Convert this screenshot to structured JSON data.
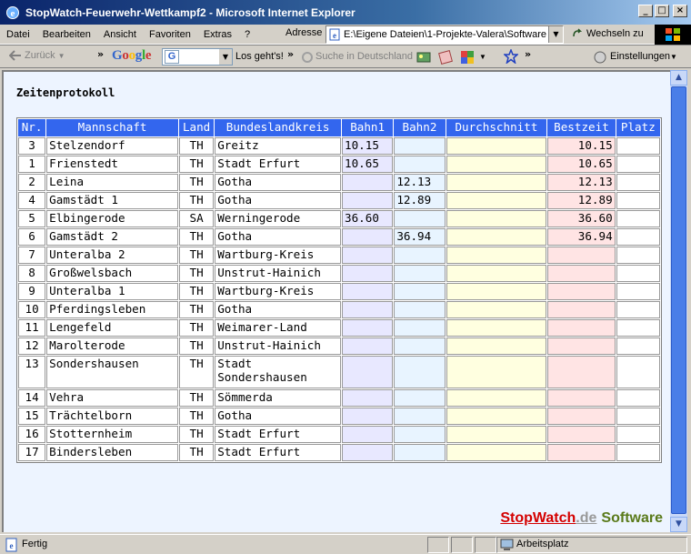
{
  "window": {
    "title": "StopWatch-Feuerwehr-Wettkampf2 - Microsoft Internet Explorer"
  },
  "menu": {
    "items": [
      "Datei",
      "Bearbeiten",
      "Ansicht",
      "Favoriten",
      "Extras",
      "?"
    ]
  },
  "address": {
    "label": "Adresse",
    "value": "E:\\Eigene Dateien\\1-Projekte-Valera\\Software",
    "go_label": "Wechseln zu"
  },
  "toolbar": {
    "back_label": "Zurück",
    "google_logo": "Google",
    "google_g": "G",
    "go_label": "Los geht's!",
    "search_de_label": "Suche in Deutschland",
    "settings_label": "Einstellungen"
  },
  "page": {
    "heading": "Zeitenprotokoll",
    "columns": [
      "Nr.",
      "Mannschaft",
      "Land",
      "Bundeslandkreis",
      "Bahn1",
      "Bahn2",
      "Durchschnitt",
      "Bestzeit",
      "Platz"
    ],
    "rows": [
      {
        "nr": "3",
        "team": "Stelzendorf",
        "land": "TH",
        "kreis": "Greitz",
        "bahn1": "10.15",
        "bahn2": "",
        "avg": "",
        "best": "10.15",
        "platz": ""
      },
      {
        "nr": "1",
        "team": "Frienstedt",
        "land": "TH",
        "kreis": "Stadt Erfurt",
        "bahn1": "10.65",
        "bahn2": "",
        "avg": "",
        "best": "10.65",
        "platz": ""
      },
      {
        "nr": "2",
        "team": "Leina",
        "land": "TH",
        "kreis": "Gotha",
        "bahn1": "",
        "bahn2": "12.13",
        "avg": "",
        "best": "12.13",
        "platz": ""
      },
      {
        "nr": "4",
        "team": "Gamstädt 1",
        "land": "TH",
        "kreis": "Gotha",
        "bahn1": "",
        "bahn2": "12.89",
        "avg": "",
        "best": "12.89",
        "platz": ""
      },
      {
        "nr": "5",
        "team": "Elbingerode",
        "land": "SA",
        "kreis": "Werningerode",
        "bahn1": "36.60",
        "bahn2": "",
        "avg": "",
        "best": "36.60",
        "platz": ""
      },
      {
        "nr": "6",
        "team": "Gamstädt 2",
        "land": "TH",
        "kreis": "Gotha",
        "bahn1": "",
        "bahn2": "36.94",
        "avg": "",
        "best": "36.94",
        "platz": ""
      },
      {
        "nr": "7",
        "team": "Unteralba 2",
        "land": "TH",
        "kreis": "Wartburg-Kreis",
        "bahn1": "",
        "bahn2": "",
        "avg": "",
        "best": "",
        "platz": ""
      },
      {
        "nr": "8",
        "team": "Großwelsbach",
        "land": "TH",
        "kreis": "Unstrut-Hainich",
        "bahn1": "",
        "bahn2": "",
        "avg": "",
        "best": "",
        "platz": ""
      },
      {
        "nr": "9",
        "team": "Unteralba 1",
        "land": "TH",
        "kreis": "Wartburg-Kreis",
        "bahn1": "",
        "bahn2": "",
        "avg": "",
        "best": "",
        "platz": ""
      },
      {
        "nr": "10",
        "team": "Pferdingsleben",
        "land": "TH",
        "kreis": "Gotha",
        "bahn1": "",
        "bahn2": "",
        "avg": "",
        "best": "",
        "platz": ""
      },
      {
        "nr": "11",
        "team": "Lengefeld",
        "land": "TH",
        "kreis": "Weimarer-Land",
        "bahn1": "",
        "bahn2": "",
        "avg": "",
        "best": "",
        "platz": ""
      },
      {
        "nr": "12",
        "team": "Marolterode",
        "land": "TH",
        "kreis": "Unstrut-Hainich",
        "bahn1": "",
        "bahn2": "",
        "avg": "",
        "best": "",
        "platz": ""
      },
      {
        "nr": "13",
        "team": "Sondershausen",
        "land": "TH",
        "kreis": "Stadt Sondershausen",
        "bahn1": "",
        "bahn2": "",
        "avg": "",
        "best": "",
        "platz": ""
      },
      {
        "nr": "14",
        "team": "Vehra",
        "land": "TH",
        "kreis": "Sömmerda",
        "bahn1": "",
        "bahn2": "",
        "avg": "",
        "best": "",
        "platz": ""
      },
      {
        "nr": "15",
        "team": "Trächtelborn",
        "land": "TH",
        "kreis": "Gotha",
        "bahn1": "",
        "bahn2": "",
        "avg": "",
        "best": "",
        "platz": ""
      },
      {
        "nr": "16",
        "team": "Stotternheim",
        "land": "TH",
        "kreis": "Stadt Erfurt",
        "bahn1": "",
        "bahn2": "",
        "avg": "",
        "best": "",
        "platz": ""
      },
      {
        "nr": "17",
        "team": "Bindersleben",
        "land": "TH",
        "kreis": "Stadt Erfurt",
        "bahn1": "",
        "bahn2": "",
        "avg": "",
        "best": "",
        "platz": ""
      }
    ]
  },
  "brand": {
    "stop": "StopWatch",
    "de": ".de",
    "soft": "Software"
  },
  "status": {
    "left": "Fertig",
    "zone": "Arbeitsplatz"
  },
  "colors": {
    "header_blue": "#3366ee",
    "bahn1_bg": "#e8e8ff",
    "bahn2_bg": "#e8f4ff",
    "avg_bg": "#ffffe0",
    "best_bg": "#ffe4e4",
    "content_bg": "#edf4ff"
  }
}
